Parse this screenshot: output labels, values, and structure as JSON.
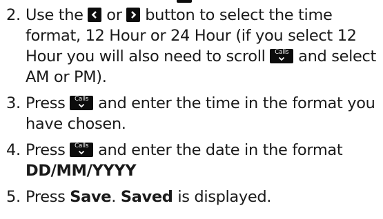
{
  "colors": {
    "text": "#1a1a1a",
    "key_background": "#0c0c0c",
    "key_foreground": "#ffffff"
  },
  "icons": {
    "left": "chevron-left-icon",
    "right": "chevron-right-icon",
    "calls_scroll": "calls-scroll-down-icon"
  },
  "key_labels": {
    "calls": "Calls"
  },
  "steps": [
    {
      "number": "2.",
      "text_a": "Use the",
      "text_b": "or",
      "text_c": "button to select the time format, 12 Hour or 24 Hour (if you select 12 Hour you will also need to scroll",
      "text_d": "and select AM or PM)."
    },
    {
      "number": "3.",
      "text_a": "Press",
      "text_b": "and enter the time in the format you have chosen."
    },
    {
      "number": "4.",
      "text_a": "Press",
      "text_b": "and enter the date in the format",
      "emphasis": "DD/MM/YYYY"
    },
    {
      "number": "5.",
      "text_a": "Press",
      "emphasis_a": "Save",
      "text_b": ".",
      "emphasis_b": "Saved",
      "text_c": "is displayed."
    }
  ]
}
